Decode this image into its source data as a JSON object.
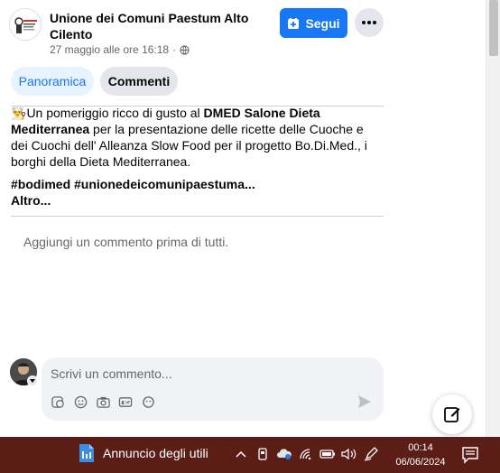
{
  "header": {
    "page_name": "Unione dei Comuni Paestum Alto Cilento",
    "post_date": "27 maggio alle ore 16:18",
    "separator": "·",
    "follow_label": "Segui"
  },
  "tabs": [
    {
      "label": "Panoramica",
      "active": true
    },
    {
      "label": "Commenti",
      "active": false
    }
  ],
  "post": {
    "emoji": "👨‍🍳",
    "text_1": "Un pomeriggio ricco di gusto al ",
    "text_bold": "DMED Salone Dieta Mediterranea",
    "text_2": " per la presentazione delle ricette delle Cuoche e dei Cuochi dell' Alleanza Slow Food per il progetto Bo.Di.Med., i borghi della Dieta Mediterranea.",
    "hashtags": "#bodimed #unionedeicomunipaestuma...",
    "more": "Altro..."
  },
  "comments": {
    "empty_text": "Aggiungi un commento prima di tutti.",
    "input_placeholder": "Scrivi un commento..."
  },
  "taskbar": {
    "app_label": "Annuncio degli utili",
    "time": "00:14",
    "date": "06/06/2024"
  },
  "colors": {
    "accent": "#1877f2",
    "taskbar": "#5a1e16"
  }
}
